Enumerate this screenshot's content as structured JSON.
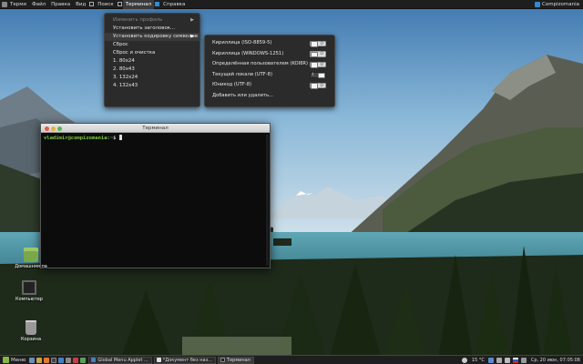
{
  "top_panel": {
    "menus": [
      "Терми",
      "Файл",
      "Правка",
      "Вид",
      "Поиск",
      "Терминал",
      "Справка"
    ],
    "user": "Compizomania"
  },
  "terminal_menu": {
    "items": [
      {
        "label": "Изменить профиль",
        "disabled": true,
        "submenu": true
      },
      {
        "label": "Установить заголовок...",
        "disabled": false,
        "submenu": false
      },
      {
        "label": "Установить кодировку символов",
        "disabled": false,
        "submenu": true
      },
      {
        "label": "Сброс",
        "disabled": false,
        "submenu": false
      },
      {
        "label": "Сброс и очистка",
        "disabled": false,
        "submenu": false
      },
      {
        "label": "1. 80x24",
        "disabled": false,
        "submenu": false
      },
      {
        "label": "2. 80x43",
        "disabled": false,
        "submenu": false
      },
      {
        "label": "3. 132x24",
        "disabled": false,
        "submenu": false
      },
      {
        "label": "4. 132x43",
        "disabled": false,
        "submenu": false
      }
    ]
  },
  "encoding_menu": {
    "items": [
      {
        "label": "Кириллица (ISO-8859-5)",
        "toggle": "O",
        "on": false
      },
      {
        "label": "Кириллица (WINDOWS-1251)",
        "toggle": "O",
        "on": false
      },
      {
        "label": "Определённая пользователем (KOI8R)",
        "toggle": "O",
        "on": false
      },
      {
        "label": "Текущей локали (UTF-8)",
        "toggle": "I",
        "on": true
      },
      {
        "label": "Юникод (UTF-8)",
        "toggle": "O",
        "on": false
      },
      {
        "label": "Добавить или удалить...",
        "toggle": null,
        "on": false
      }
    ]
  },
  "terminal": {
    "title": "Терминал",
    "prompt_user": "vladimir@compizomania",
    "prompt_path": "~",
    "prompt_symbol": "$"
  },
  "desktop_icons": {
    "home": "Домашняя па",
    "computer": "Компьютер",
    "trash": "Корзина"
  },
  "bottom_panel": {
    "menu_label": "Меню",
    "tasks": [
      {
        "label": "Global Menu Applet ...",
        "active": false
      },
      {
        "label": "*Документ без наз...",
        "active": false
      },
      {
        "label": "Терминал",
        "active": true
      }
    ],
    "temperature": "15 °C",
    "clock": "Ср, 20 июн, 07:05:08"
  },
  "colors": {
    "panel_bg": "#1e1e1e",
    "menu_bg": "#2b2b2b",
    "prompt_user": "#7ecb3a",
    "prompt_path": "#5b8fd8",
    "brand_green": "#86b740"
  }
}
